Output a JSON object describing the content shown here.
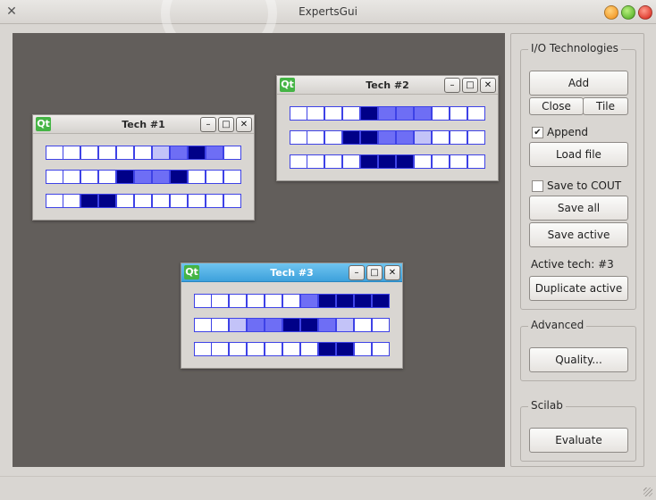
{
  "window": {
    "title": "ExpertsGui"
  },
  "colors": {
    "dark": "#000088",
    "medium": "#6e6ef5",
    "light": "#c3c3f8",
    "empty": "#ffffff",
    "border": "#3e42e6"
  },
  "techs": [
    {
      "title": "Tech #1",
      "qt_label": "Qt",
      "active": false,
      "rows": [
        [
          0,
          0,
          0,
          0,
          0,
          0,
          1,
          2,
          3,
          2,
          0
        ],
        [
          0,
          0,
          0,
          0,
          3,
          2,
          2,
          3,
          0,
          0,
          0
        ],
        [
          0,
          0,
          3,
          3,
          0,
          0,
          0,
          0,
          0,
          0,
          0
        ]
      ]
    },
    {
      "title": "Tech #2",
      "qt_label": "Qt",
      "active": false,
      "rows": [
        [
          0,
          0,
          0,
          0,
          3,
          2,
          2,
          2,
          0,
          0,
          0
        ],
        [
          0,
          0,
          0,
          3,
          3,
          2,
          2,
          1,
          0,
          0,
          0
        ],
        [
          0,
          0,
          0,
          0,
          3,
          3,
          3,
          0,
          0,
          0,
          0
        ]
      ]
    },
    {
      "title": "Tech #3",
      "qt_label": "Qt",
      "active": true,
      "rows": [
        [
          0,
          0,
          0,
          0,
          0,
          0,
          2,
          3,
          3,
          3,
          3
        ],
        [
          0,
          0,
          1,
          2,
          2,
          3,
          3,
          2,
          1,
          0,
          0
        ],
        [
          0,
          0,
          0,
          0,
          0,
          0,
          0,
          3,
          3,
          0,
          0
        ]
      ]
    }
  ],
  "panel": {
    "io_title": "I/O Technologies",
    "add_label": "Add",
    "close_label": "Close",
    "tile_label": "Tile",
    "append_label": "Append",
    "append_checked": true,
    "load_label": "Load file",
    "save_cout_label": "Save to COUT",
    "save_cout_checked": false,
    "save_all_label": "Save all",
    "save_active_label": "Save active",
    "active_tech_label": "Active tech: #3",
    "duplicate_label": "Duplicate active",
    "advanced_title": "Advanced",
    "quality_label": "Quality...",
    "scilab_title": "Scilab",
    "evaluate_label": "Evaluate"
  }
}
